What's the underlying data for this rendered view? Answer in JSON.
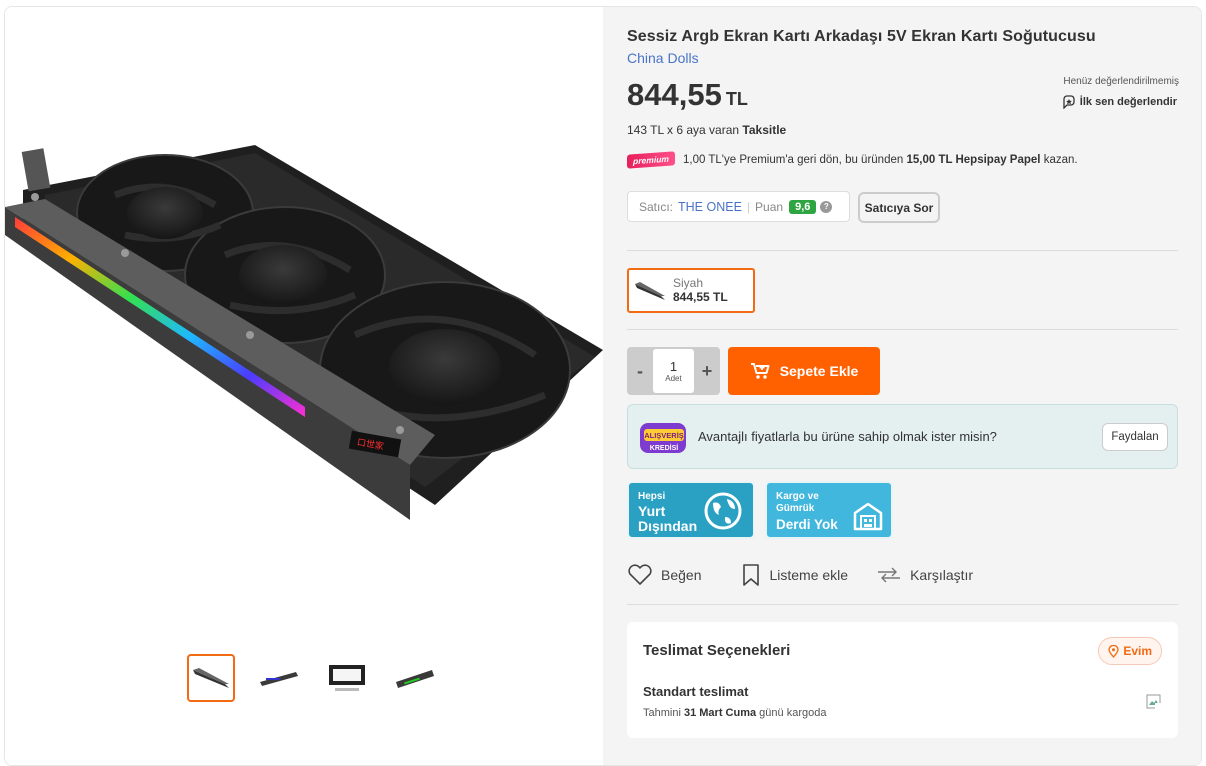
{
  "product": {
    "title": "Sessiz Argb Ekran Kartı Arkadaşı 5V Ekran Kartı Soğutucusu",
    "brand": "China Dolls",
    "price": "844,55",
    "currency": "TL",
    "rating_status": "Henüz değerlendirilmemiş",
    "rate_first": "İlk sen değerlendir",
    "installment_prefix": "143 TL x 6 aya varan",
    "installment_label": "Taksitle"
  },
  "premium": {
    "badge": "premium",
    "text_a": "1,00 TL'ye Premium'a geri dön, bu üründen",
    "text_bold": "15,00 TL Hepsipay Papel",
    "text_b": "kazan."
  },
  "seller": {
    "label": "Satıcı:",
    "name": "THE ONEE",
    "score_label": "Puan",
    "score": "9,6",
    "help": "?",
    "ask_button": "Satıcıya Sor"
  },
  "variant": {
    "name": "Siyah",
    "price": "844,55 TL"
  },
  "cart": {
    "minus": "-",
    "plus": "+",
    "quantity": "1",
    "unit": "Adet",
    "add_button": "Sepete Ekle"
  },
  "credit_banner": {
    "logo_top": "ALIŞVERİŞ",
    "logo_bottom": "KREDİSİ",
    "text": "Avantajlı fiyatlarla bu ürüne sahip olmak ister misin?",
    "button": "Faydalan"
  },
  "tiles": [
    {
      "small": "Hepsi",
      "big1": "Yurt",
      "big2": "Dışından"
    },
    {
      "small1": "Kargo ve",
      "small2": "Gümrük",
      "big": "Derdi Yok"
    }
  ],
  "actions": {
    "like": "Beğen",
    "list": "Listeme ekle",
    "compare": "Karşılaştır"
  },
  "delivery": {
    "title": "Teslimat Seçenekleri",
    "location": "Evim",
    "option": "Standart teslimat",
    "date_prefix": "Tahmini",
    "date": "31 Mart Cuma",
    "date_suffix": "günü kargoda"
  },
  "colors": {
    "accent": "#ff6000",
    "link": "#4a73c7",
    "score_green": "#2fa443"
  }
}
